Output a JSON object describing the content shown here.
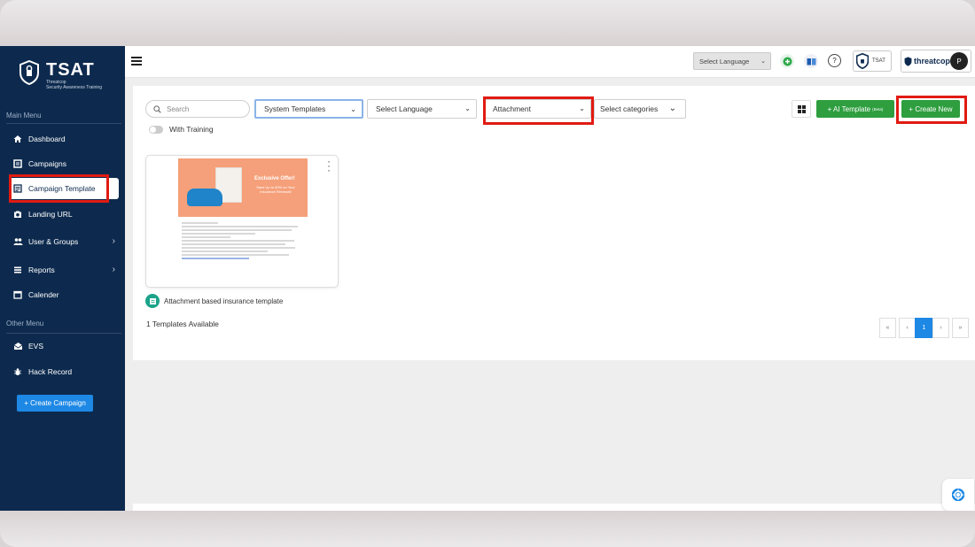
{
  "brand": {
    "title": "TSAT",
    "subtitle_line1": "Threatcop",
    "subtitle_line2": "Security Awareness Training"
  },
  "sidebar": {
    "main_menu_heading": "Main Menu",
    "items": [
      {
        "label": "Dashboard",
        "icon": "home-icon"
      },
      {
        "label": "Campaigns",
        "icon": "campaign-icon"
      },
      {
        "label": "Campaign Template",
        "icon": "template-icon",
        "active": true
      },
      {
        "label": "Landing URL",
        "icon": "camera-icon"
      },
      {
        "label": "User & Groups",
        "icon": "users-icon"
      },
      {
        "label": "Reports",
        "icon": "reports-icon"
      },
      {
        "label": "Calender",
        "icon": "calendar-icon"
      }
    ],
    "other_menu_heading": "Other Menu",
    "other_items": [
      {
        "label": "EVS",
        "icon": "mail-icon"
      },
      {
        "label": "Hack Record",
        "icon": "bug-icon"
      }
    ],
    "create_campaign_label": "+ Create Campaign"
  },
  "topbar": {
    "language_select": "Select Language",
    "tsat_label": "TSAT",
    "threatcop_label": "threatcop",
    "avatar_initial": "P"
  },
  "filters": {
    "search_placeholder": "Search",
    "template_source": "System Templates",
    "language": "Select Language",
    "type": "Attachment",
    "categories": "Select categories",
    "with_training_label": "With Training"
  },
  "actions": {
    "ai_template_label": "+ AI Template",
    "ai_template_badge": "(Beta)",
    "create_new_label": "+ Create New"
  },
  "templates": [
    {
      "name": "Attachment based insurance template",
      "thumb_offer": "Exclusive Offer!",
      "thumb_offer_sub": "Save Up to 60% on Your Insurance Renewal!"
    }
  ],
  "count_label": "1 Templates Available",
  "pagination": {
    "first": "«",
    "prev": "‹",
    "current": "1",
    "next": "›",
    "last": "»"
  },
  "colors": {
    "sidebar_bg": "#0d2a4e",
    "accent_blue": "#1e88e5",
    "green": "#2e9e3f",
    "highlight_red": "#e01b12"
  }
}
